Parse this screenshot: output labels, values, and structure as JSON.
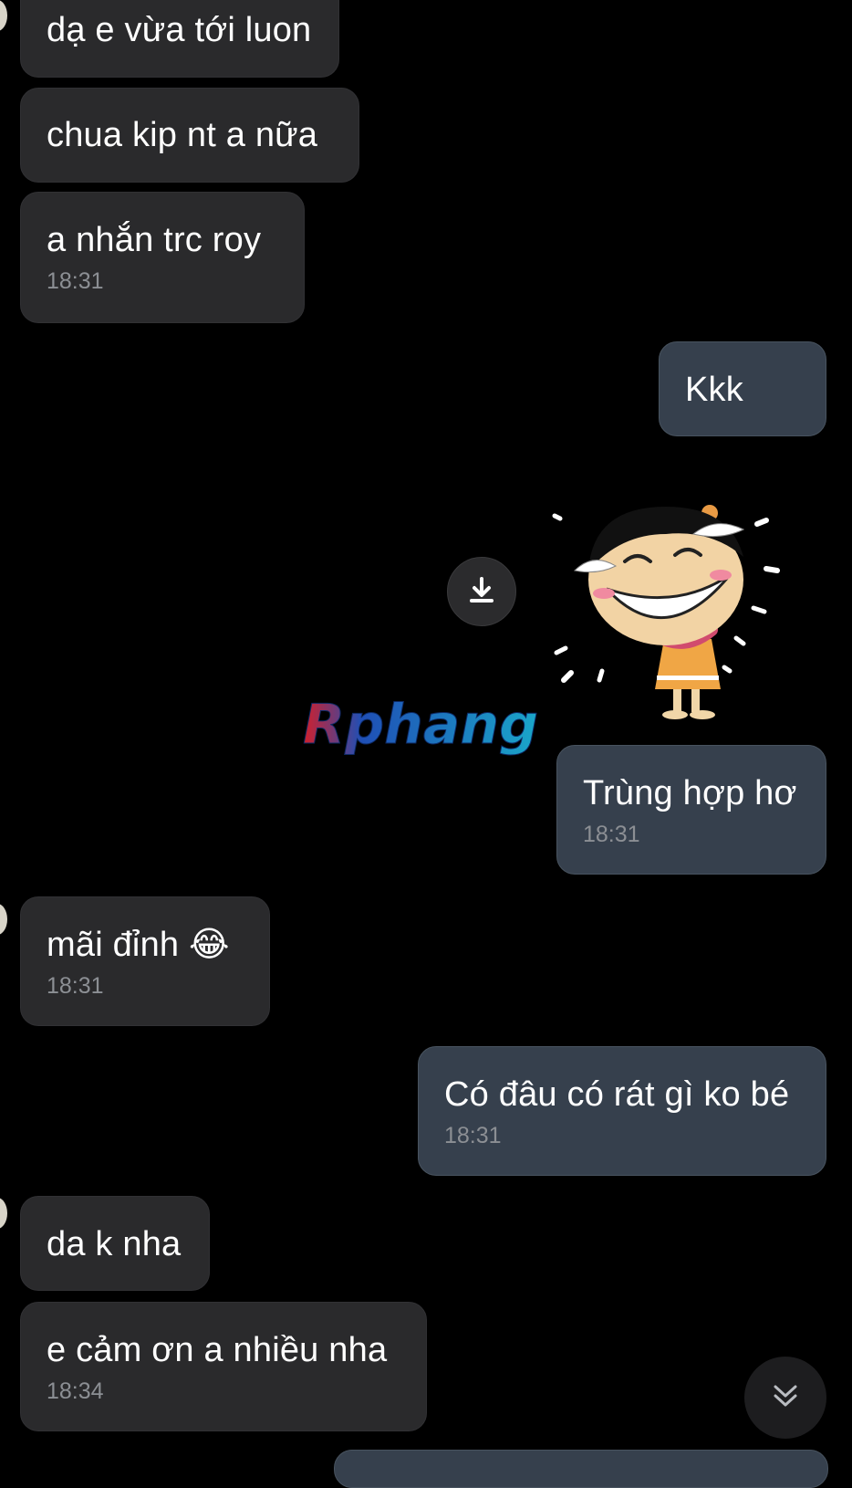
{
  "chat": {
    "messages": [
      {
        "side": "in",
        "text": "dạ e vừa tới luon"
      },
      {
        "side": "in",
        "text": "chua kip nt a nữa"
      },
      {
        "side": "in",
        "text": "a nhắn trc roy",
        "time": "18:31"
      },
      {
        "side": "out",
        "text": "Kkk"
      },
      {
        "side": "out",
        "type": "sticker",
        "sticker": "laughing-girl-sticker"
      },
      {
        "side": "out",
        "text": "Trùng hợp hơ",
        "time": "18:31"
      },
      {
        "side": "in",
        "text": "mãi đỉnh 😂",
        "time": "18:31"
      },
      {
        "side": "out",
        "text": "Có đâu có rát gì ko bé",
        "time": "18:31"
      },
      {
        "side": "in",
        "text": "da k nha"
      },
      {
        "side": "in",
        "text": "e cảm ơn a nhiều nha",
        "time": "18:34"
      }
    ]
  },
  "watermark": {
    "text": "Rphang"
  },
  "icons": {
    "download": "download-icon",
    "scroll_down": "double-chevron-down-icon"
  },
  "colors": {
    "background": "#000000",
    "incoming_bubble": "#2a2a2c",
    "outgoing_bubble": "#36404d",
    "timestamp": "#8c8f94"
  }
}
